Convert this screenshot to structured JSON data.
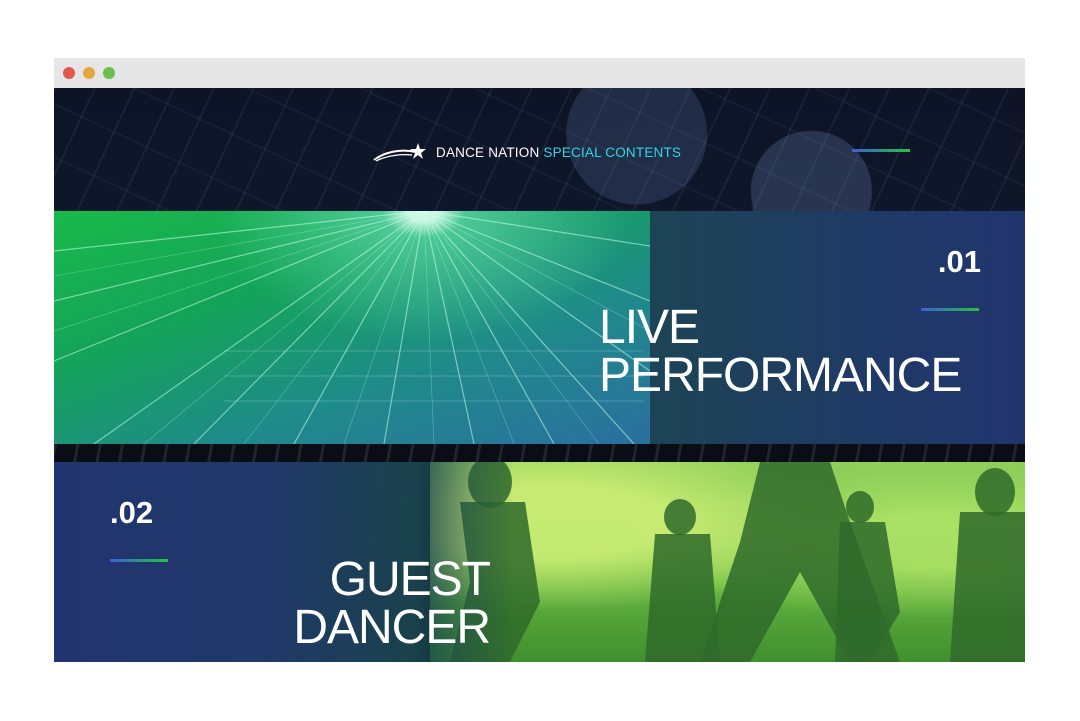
{
  "header": {
    "logo_text": "DANCE NATION",
    "logo_accent": "SPECIAL CONTENTS",
    "menu_icon": "menu-bar-icon"
  },
  "sections": [
    {
      "number": ".01",
      "title_line1": "LIVE",
      "title_line2": "PERFORMANCE"
    },
    {
      "number": ".02",
      "title_line1": "GUEST",
      "title_line2": "DANCER"
    }
  ],
  "colors": {
    "accent_cyan": "#33d4e6",
    "accent_blue": "#3a5fd8",
    "accent_green": "#26c43a",
    "panel_navy": "#22346f"
  }
}
